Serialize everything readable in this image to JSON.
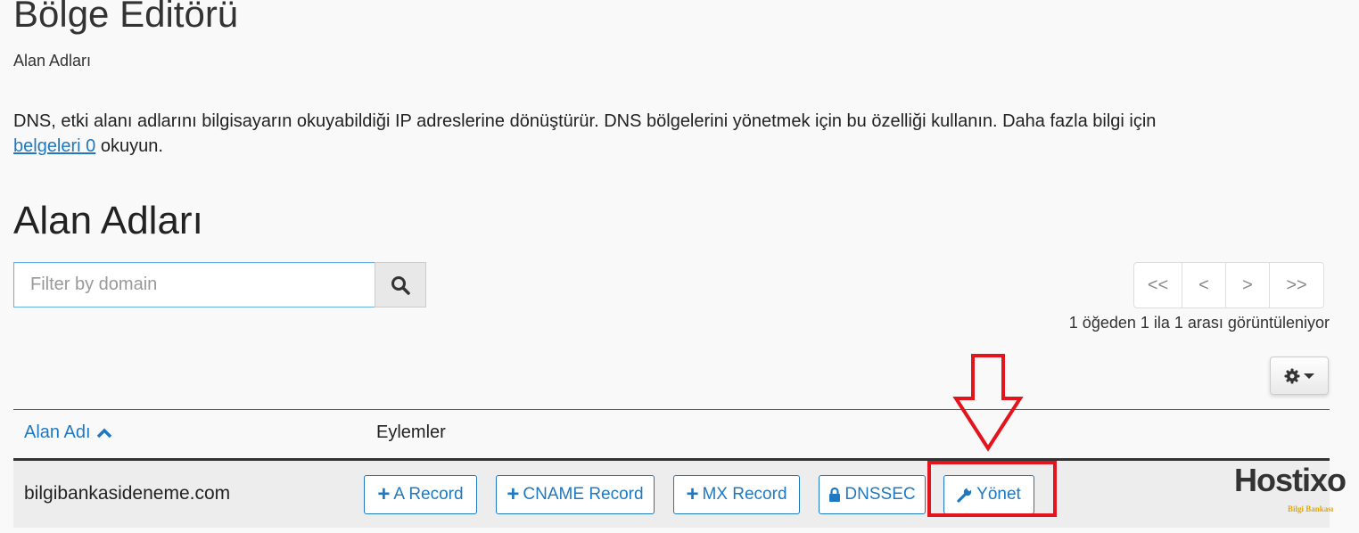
{
  "header": {
    "title": "Bölge Editörü",
    "subtitle": "Alan Adları"
  },
  "description": {
    "text": "DNS, etki alanı adlarını bilgisayarın okuyabildiği IP adreslerine dönüştürür. DNS bölgelerini yönetmek için bu özelliği kullanın. Daha fazla bilgi için",
    "link": "belgeleri 0",
    "suffix": "okuyun."
  },
  "section": {
    "title": "Alan Adları"
  },
  "search": {
    "placeholder": "Filter by domain",
    "icon": "search-icon"
  },
  "pagination": {
    "first": "<<",
    "prev": "<",
    "next": ">",
    "last": ">>"
  },
  "count_text": "1 öğeden 1 ila 1 arası görüntüleniyor",
  "table": {
    "columns": {
      "domain": "Alan Adı",
      "actions": "Eylemler"
    },
    "rows": [
      {
        "domain": "bilgibankasideneme.com",
        "actions": {
          "a_record": "A Record",
          "cname_record": "CNAME Record",
          "mx_record": "MX Record",
          "dnssec": "DNSSEC",
          "manage": "Yönet"
        }
      }
    ]
  },
  "logo": {
    "name": "Hostixo",
    "tagline": "Bilgi Bankası"
  },
  "colors": {
    "link": "#1f78c2",
    "highlight": "#e3141c",
    "row_bg": "#ededed"
  }
}
